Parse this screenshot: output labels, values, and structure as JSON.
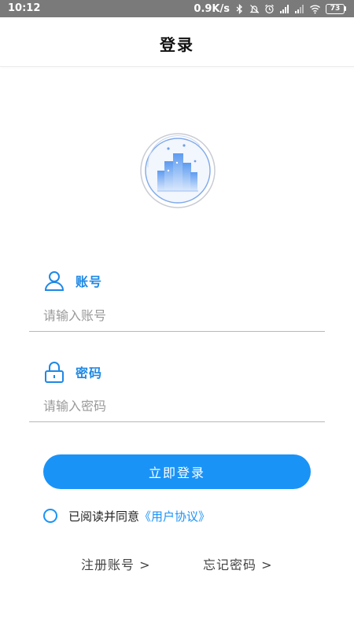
{
  "status_bar": {
    "time": "10:12",
    "network_speed": "0.9K/s",
    "battery": "73",
    "icons": [
      "bluetooth-icon",
      "mute-icon",
      "alarm-icon",
      "signal-icon",
      "signal-icon",
      "wifi-icon",
      "battery-icon"
    ]
  },
  "header": {
    "title": "登录"
  },
  "form": {
    "account": {
      "label": "账号",
      "placeholder": "请输入账号",
      "value": "",
      "icon": "user-icon"
    },
    "password": {
      "label": "密码",
      "placeholder": "请输入密码",
      "value": "",
      "icon": "lock-icon"
    }
  },
  "login_button": {
    "label": "立即登录"
  },
  "agreement": {
    "text": "已阅读并同意",
    "link": "《用户协议》",
    "checked": false
  },
  "links": {
    "register": "注册账号 >",
    "forgot": "忘记密码 >"
  },
  "colors": {
    "accent": "#1a93f7",
    "label": "#1e88e5",
    "status_bar": "#7a7a7a"
  }
}
